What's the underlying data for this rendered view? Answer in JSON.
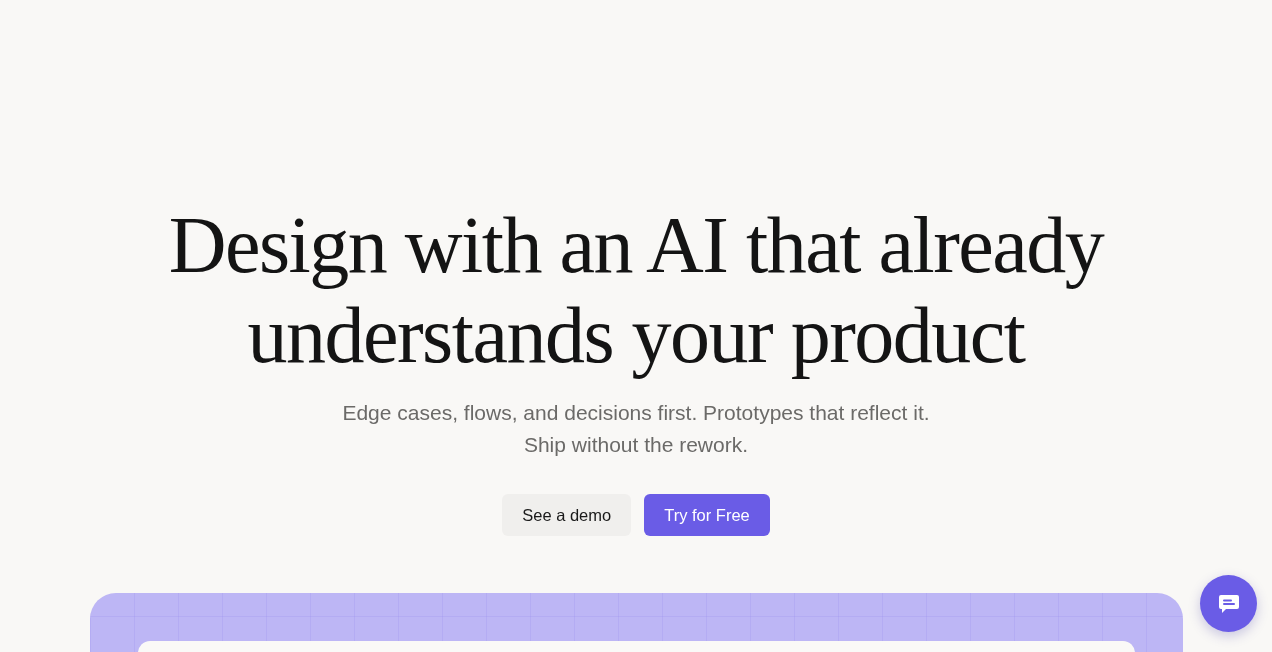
{
  "hero": {
    "headline": "Design with an AI that already understands your product",
    "subtitle": "Edge cases, flows, and decisions first. Prototypes that reflect it. Ship without the rework.",
    "actions": [
      {
        "label": "See a demo",
        "kind": "secondary"
      },
      {
        "label": "Try for Free",
        "kind": "primary"
      }
    ]
  }
}
